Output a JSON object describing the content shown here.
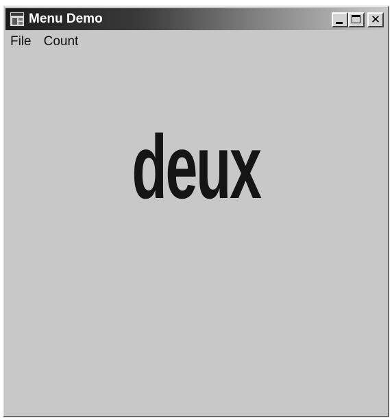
{
  "window": {
    "title": "Menu Demo"
  },
  "titlebar": {
    "buttons": [
      {
        "name": "minimize",
        "icon": "minimize-icon"
      },
      {
        "name": "maximize",
        "icon": "maximize-icon"
      },
      {
        "name": "close",
        "icon": "close-icon"
      }
    ]
  },
  "menubar": {
    "items": [
      {
        "label": "File"
      },
      {
        "label": "Count"
      }
    ]
  },
  "content": {
    "word": "deux"
  },
  "colors": {
    "background": "#c8c8c8",
    "text": "#151515",
    "title_text": "#ffffff"
  }
}
